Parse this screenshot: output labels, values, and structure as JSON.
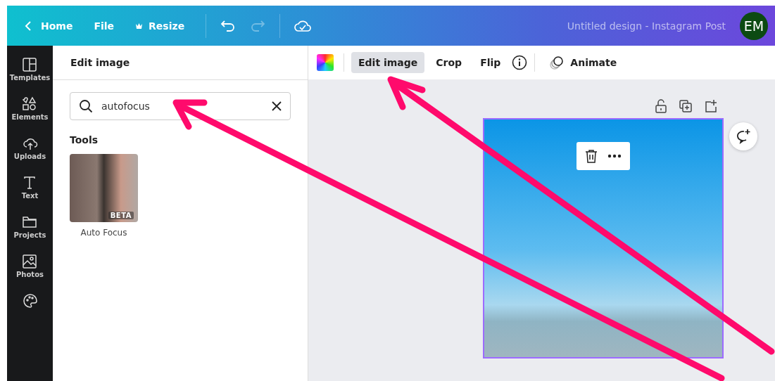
{
  "topbar": {
    "back": "Home",
    "menu": [
      {
        "kind": "file",
        "label": "File"
      },
      {
        "kind": "resize",
        "label": "Resize"
      }
    ],
    "history": [
      {
        "kind": "undo",
        "disabled": false
      },
      {
        "kind": "redo",
        "disabled": true
      }
    ],
    "title": "Untitled design - Instagram Post",
    "avatar": "EM"
  },
  "sidebar": {
    "items": [
      {
        "kind": "templates",
        "label": "Templates"
      },
      {
        "kind": "elements",
        "label": "Elements"
      },
      {
        "kind": "uploads",
        "label": "Uploads"
      },
      {
        "kind": "text",
        "label": "Text"
      },
      {
        "kind": "projects",
        "label": "Projects"
      },
      {
        "kind": "photos",
        "label": "Photos"
      },
      {
        "kind": "palette"
      }
    ]
  },
  "panel": {
    "title": "Edit image",
    "search": {
      "value": "autofocus"
    },
    "section": "Tools",
    "tools": [
      {
        "label": "Auto Focus",
        "badge": "BETA"
      }
    ]
  },
  "toolbar": {
    "items": [
      {
        "label": "Edit image",
        "selected": true
      },
      {
        "label": "Crop",
        "selected": false
      },
      {
        "label": "Flip",
        "selected": false
      }
    ],
    "animate": "Animate"
  }
}
